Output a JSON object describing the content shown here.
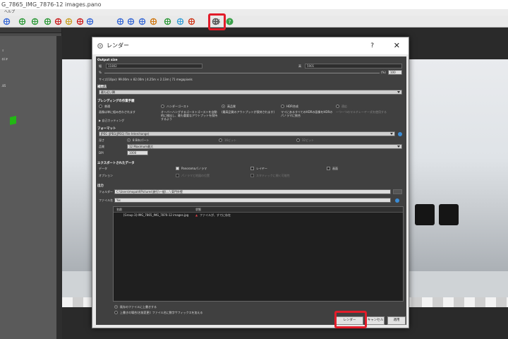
{
  "window": {
    "title": "G_7865_IMG_7876-12 images.pano"
  },
  "menu": {
    "help": "ヘルプ"
  },
  "toolbar": {
    "icon_names": [
      "panorama-icon",
      "target-icon",
      "target-icon",
      "target-icon",
      "crop-icon",
      "image-icon",
      "arrow-icon",
      "cursor-icon",
      "move-icon",
      "points-icon",
      "mask-icon",
      "color-wheel-icon",
      "image-icon",
      "layers-icon",
      "export-icon",
      "gear-icon",
      "wrench-icon",
      "help-icon"
    ],
    "accent": "#e21c2a"
  },
  "left_panel": {
    "items": [
      "ゞ",
      "る(キ"
    ],
    "value": ".85"
  },
  "dialog": {
    "title": "レンダー",
    "help": "?",
    "close": "✕",
    "output_size": {
      "title": "Output size",
      "width_label": "幅",
      "width_value": "11802",
      "height_label": "高",
      "height_value": "5901",
      "percent_label": "%",
      "percent_right_label": "(%)",
      "percent_value": "100",
      "size_info": "サイズ(10px): 99.00m × 82.00m | 4.25m × 2.13m | 71 megapixels"
    },
    "projection": {
      "title": "補間法",
      "value": "最も近い隣"
    },
    "blending": {
      "title": "ブレンディングの作業手順",
      "options": [
        "普通",
        "ハンダーゴースト",
        "高品質",
        "HDR合成",
        "適応"
      ],
      "desc1": "画像は単に組み合わされます",
      "desc2": "オーバーハングするゴーストゴーストを自動的に検出し、最も重要なアウトプットを保持するよう",
      "desc3": "(最高品質のアウトプットが保持されます)",
      "desc4": "マイにあるすべてのHDRの画像をHDRのパノラマに統合",
      "desc5": "一つ一つのマルチレーヤー式を使用する",
      "auto_cut": "自己カッティング"
    },
    "format": {
      "title": "フォーマット",
      "value": "JPEG (JPEG(JPEG) File Interchange)",
      "quality_label": "深さ",
      "quality_opts": [
        "8 Bitsパート",
        "16ビット",
        "32ビット"
      ],
      "compress_label": "品質",
      "compress_value": "12 Maximum最大",
      "dpi_label": "DPI",
      "dpi_value": "1000"
    },
    "export": {
      "title": "エクスポートされたデータ",
      "data_label": "データ",
      "layers_label": "レイヤー",
      "options_label": "オプション",
      "panorama": "Panoramaパノラマ",
      "layer": "レイヤー",
      "mask": "画面",
      "opt1": "パノラマと地図の位置",
      "opt2": "スタティックに開く可能性"
    },
    "output": {
      "title": "出力",
      "folder_label": "フォルダー",
      "folder_value": "C:\\Users\\mopald\\Pictures\\旅行\\一般\\... \\ 東門外壁",
      "filename_label": "ファイル名",
      "filename_value": "%s",
      "col_name": "名前",
      "col_state": "状態",
      "rows": [
        {
          "name": "[Group 3]-IMG_7865_IMG_7876-12 images.jpg",
          "state": "ファイルが、すでに存在"
        }
      ]
    },
    "overwrite1": "既存のファイルに上書きする",
    "overwrite2": "上書きの場合(名前変更): ファイル名に数字サフィックスを加える",
    "buttons": {
      "render": "レンダー",
      "cancel": "キャンセル",
      "apply": "適用"
    }
  }
}
